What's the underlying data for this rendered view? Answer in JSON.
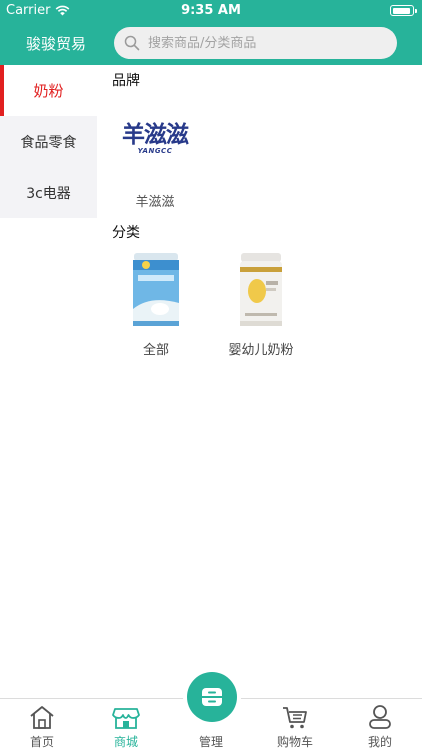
{
  "status_bar": {
    "carrier": "Carrier",
    "time": "9:35 AM"
  },
  "header": {
    "shop_name": "骏骏贸易",
    "search_placeholder": "搜索商品/分类商品"
  },
  "sidebar": {
    "items": [
      {
        "label": "奶粉",
        "active": true
      },
      {
        "label": "食品零食",
        "active": false
      },
      {
        "label": "3c电器",
        "active": false
      }
    ]
  },
  "main": {
    "brand_section_title": "品牌",
    "brands": [
      {
        "name": "羊滋滋",
        "logo_text": "羊滋滋",
        "logo_subtext": "YANGCC"
      }
    ],
    "category_section_title": "分类",
    "categories": [
      {
        "name": "全部"
      },
      {
        "name": "婴幼儿奶粉"
      }
    ]
  },
  "tabbar": {
    "tabs": [
      {
        "label": "首页",
        "icon": "home-icon"
      },
      {
        "label": "商城",
        "icon": "shop-icon",
        "active": true
      },
      {
        "label": "管理",
        "icon": "manage-icon"
      },
      {
        "label": "购物车",
        "icon": "cart-icon"
      },
      {
        "label": "我的",
        "icon": "user-icon"
      }
    ]
  },
  "colors": {
    "accent": "#27b39a",
    "active_side": "#e12020",
    "brand_logo": "#283a8a"
  }
}
